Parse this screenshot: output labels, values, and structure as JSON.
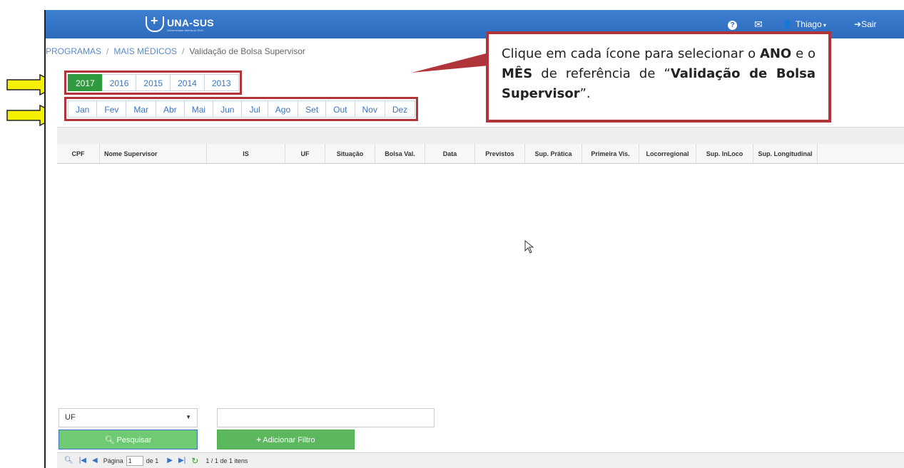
{
  "header": {
    "brand": "UNA-SUS",
    "brand_sub": "Universidade Aberta do SUS",
    "user": "Thiago",
    "logout": "Sair",
    "icons": [
      "help-icon",
      "mail-icon",
      "user-icon",
      "logout-icon"
    ]
  },
  "breadcrumb": {
    "item1": "PROGRAMAS",
    "item2": "MAIS MÉDICOS",
    "current": "Validação de Bolsa Supervisor"
  },
  "years": [
    "2017",
    "2016",
    "2015",
    "2014",
    "2013"
  ],
  "active_year": "2017",
  "months": [
    "Jan",
    "Fev",
    "Mar",
    "Abr",
    "Mai",
    "Jun",
    "Jul",
    "Ago",
    "Set",
    "Out",
    "Nov",
    "Dez"
  ],
  "grid": {
    "columns": [
      "CPF",
      "Nome Supervisor",
      "IS",
      "UF",
      "Situação",
      "Bolsa Val.",
      "Data",
      "Previstos",
      "Sup. Prática",
      "Primeira Vis.",
      "Locorregional",
      "Sup. InLoco",
      "Sup. Longitudinal"
    ]
  },
  "filter": {
    "select_value": "UF",
    "input_value": ""
  },
  "buttons": {
    "search": "Pesquisar",
    "add_filter": "Adicionar Filtro"
  },
  "pager": {
    "page_label": "Página",
    "page_value": "1",
    "of_label": "de 1",
    "items": "1 / 1 de 1 itens"
  },
  "callout": {
    "p1": "Clique em cada ícone para selecionar o ",
    "b1": "ANO",
    "p2": " e o ",
    "b2": "MÊS",
    "p3": " de referência de “",
    "b3": "Validação de Bolsa Supervisor",
    "p4": "”."
  },
  "colors": {
    "topbar": "#2d6bbd",
    "active_tab": "#2f9a3f",
    "annotation_border": "#b0353a",
    "arrow": "#f5f000"
  }
}
